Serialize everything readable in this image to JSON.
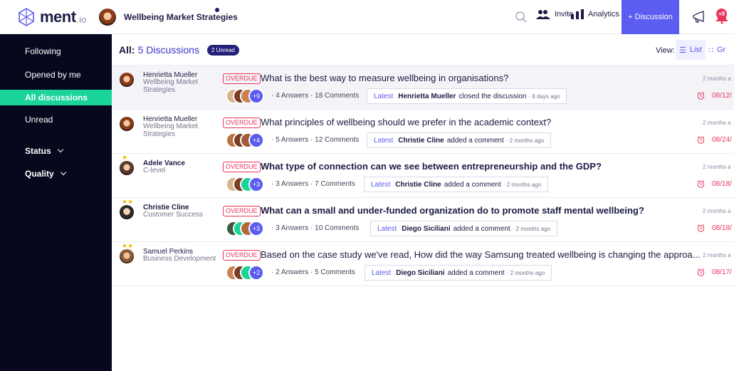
{
  "header": {
    "brand": "ment",
    "brand_tld": ".io",
    "group_name": "Wellbeing Market Strategies",
    "invite_label": "Invite",
    "analytics_label": "Analytics",
    "new_discussion_label": "+ Discussion",
    "notification_count": "+9"
  },
  "sidebar": {
    "items": [
      {
        "label": "Following"
      },
      {
        "label": "Opened by me"
      },
      {
        "label": "All discussions"
      },
      {
        "label": "Unread"
      }
    ],
    "filters": [
      {
        "label": "Status"
      },
      {
        "label": "Quality"
      }
    ]
  },
  "main": {
    "title_prefix": "All:",
    "title_count": "5 Discussions",
    "unread_badge": "2 Unread",
    "view_label": "View:",
    "view_list": "List",
    "view_grid": "Gr"
  },
  "discussions": [
    {
      "author": "Henrietta Mueller",
      "author_sub": "Wellbeing Market Strategies",
      "status": "OVERDUE",
      "question": "What is the best way to measure wellbeing in organisations?",
      "extra_count": "+9",
      "stats": "· 4 Answers · 18 Comments",
      "latest_label": "Latest",
      "latest_user": "Henrietta Mueller",
      "latest_action": "closed the discussion",
      "latest_when": "· 6 days ago",
      "ago": "2 months a",
      "due": "08/12/"
    },
    {
      "author": "Henrietta Mueller",
      "author_sub": "Wellbeing Market Strategies",
      "status": "OVERDUE",
      "question": "What principles of wellbeing should we prefer in the academic context?",
      "extra_count": "+4",
      "stats": "· 5 Answers · 12 Comments",
      "latest_label": "Latest",
      "latest_user": "Christie Cline",
      "latest_action": "added a comment",
      "latest_when": "· 2 months ago",
      "ago": "2 months a",
      "due": "08/24/"
    },
    {
      "author": "Adele Vance",
      "author_sub": "C-level",
      "status": "OVERDUE",
      "question": "What type of connection can we see between entrepreneurship and the GDP?",
      "extra_count": "+3",
      "stats": "· 3 Answers · 7 Comments",
      "latest_label": "Latest",
      "latest_user": "Christie Cline",
      "latest_action": "added a comment",
      "latest_when": "· 2 months ago",
      "ago": "2 months a",
      "due": "08/18/"
    },
    {
      "author": "Christie Cline",
      "author_sub": "Customer Success",
      "status": "OVERDUE",
      "question": "What can a small and under-funded organization do to promote staff mental wellbeing?",
      "extra_count": "+3",
      "stats": "· 3 Answers · 10 Comments",
      "latest_label": "Latest",
      "latest_user": "Diego Siciliani",
      "latest_action": "added a comment",
      "latest_when": "· 2 months ago",
      "ago": "2 months a",
      "due": "08/18/"
    },
    {
      "author": "Samuel Perkins",
      "author_sub": "Business Development",
      "status": "OVERDUE",
      "question": "Based on the case study we've read, How did the way Samsung treated wellbeing is changing the approa...",
      "extra_count": "+2",
      "stats": "· 2 Answers · 5 Comments",
      "latest_label": "Latest",
      "latest_user": "Diego Siciliani",
      "latest_action": "added a comment",
      "latest_when": "· 2 months ago",
      "ago": "2 months a",
      "due": "08/17/"
    }
  ],
  "colors": {
    "accent": "#5b5cf0",
    "sidebar_bg": "#07071d",
    "active_nav": "#1bd49a",
    "overdue": "#e8365a"
  }
}
